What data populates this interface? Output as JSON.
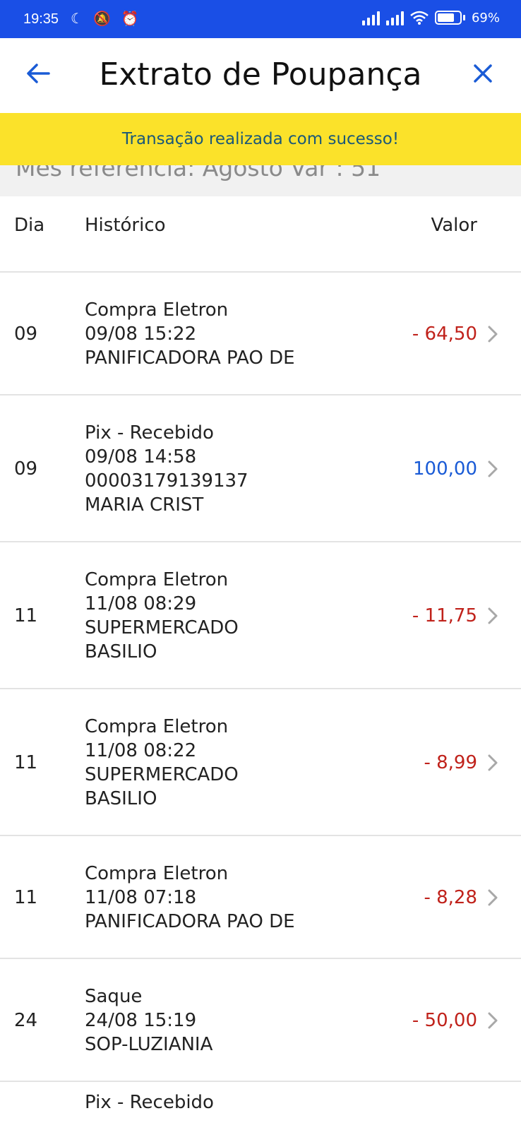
{
  "status_bar": {
    "time": "19:35",
    "left_icons": "☾ 🔕 ⏰",
    "battery": "69%"
  },
  "header": {
    "title": "Extrato de Poupança",
    "back_icon": "arrow-left-icon",
    "close_icon": "close-icon"
  },
  "toast": {
    "message": "Transação realizada com sucesso!"
  },
  "reference": {
    "text": "Mês referência: Agosto Var : 51"
  },
  "columns": {
    "day": "Dia",
    "history": "Histórico",
    "value": "Valor"
  },
  "transactions": [
    {
      "day": "09",
      "lines": [
        "Compra Eletron",
        "09/08 15:22",
        "PANIFICADORA PAO DE"
      ],
      "value": "- 64,50",
      "type": "debit"
    },
    {
      "day": "09",
      "lines": [
        "Pix - Recebido",
        "09/08 14:58",
        "00003179139137",
        "MARIA CRIST"
      ],
      "value": "100,00",
      "type": "credit"
    },
    {
      "day": "11",
      "lines": [
        "Compra Eletron",
        "11/08 08:29",
        "SUPERMERCADO",
        "BASILIO"
      ],
      "value": "- 11,75",
      "type": "debit"
    },
    {
      "day": "11",
      "lines": [
        "Compra Eletron",
        "11/08 08:22",
        "SUPERMERCADO",
        "BASILIO"
      ],
      "value": "- 8,99",
      "type": "debit"
    },
    {
      "day": "11",
      "lines": [
        "Compra Eletron",
        "11/08 07:18",
        "PANIFICADORA PAO DE"
      ],
      "value": "- 8,28",
      "type": "debit"
    },
    {
      "day": "24",
      "lines": [
        "Saque",
        "24/08 15:19",
        "SOP-LUZIANIA"
      ],
      "value": "- 50,00",
      "type": "debit"
    },
    {
      "day": "",
      "lines": [
        "Pix - Recebido"
      ],
      "value": "",
      "type": "credit"
    }
  ],
  "colors": {
    "status_bar": "#1a4fe6",
    "toast_bg": "#fbe22a",
    "debit": "#c0221b",
    "credit": "#1a5bd6"
  }
}
